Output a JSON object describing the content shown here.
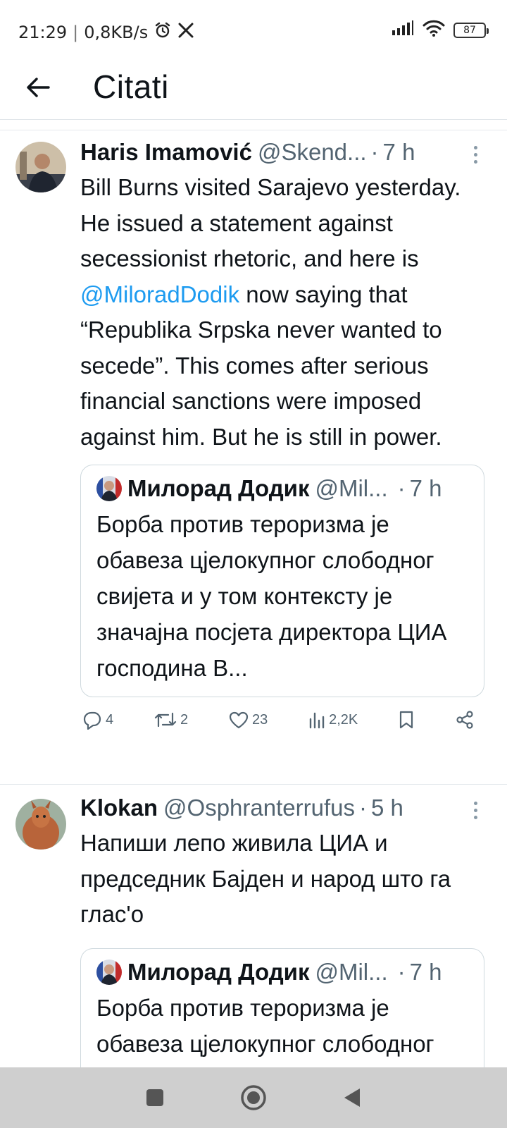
{
  "status_bar": {
    "time": "21:29",
    "speed": "0,8KB/s",
    "battery": "87",
    "icons": [
      "alarm-icon",
      "x-logo-icon",
      "signal-icon",
      "wifi-icon",
      "battery-icon"
    ]
  },
  "header": {
    "title": "Citati",
    "back_icon": "arrow-left-icon"
  },
  "tweets": [
    {
      "name": "Haris Imamović",
      "handle": "@Skend...",
      "sep": "·",
      "time": "7 h",
      "text_before": "Bill Burns visited Sarajevo yesterday. He issued a statement against secessionist rhetoric, and here is ",
      "mention": "@MiloradDodik",
      "text_after": " now saying that “Republika Srpska never wanted to secede”. This comes after serious financial sanctions were imposed against him. But he is still in power.",
      "quote": {
        "name": "Милорад Додик",
        "handle": "@Mil...",
        "sep": "·",
        "time": "7 h",
        "text": "Борба против тероризма је обавеза цјелокупног слободног свијета и у том контексту је значајна посјета директора ЦИА господина В..."
      },
      "actions": {
        "replies": "4",
        "reposts": "2",
        "likes": "23",
        "views": "2,2K"
      }
    },
    {
      "name": "Klokan",
      "handle": "@Osphranterrufus",
      "sep": "·",
      "time": "5 h",
      "text": "Напиши лепо живила ЦИА и председник Бајден и народ што га глас'о",
      "quote": {
        "name": "Милорад Додик",
        "handle": "@Mil...",
        "sep": "·",
        "time": "7 h",
        "text": "Борба против тероризма је обавеза цјелокупног слободног свијета и у том"
      }
    }
  ],
  "colors": {
    "text": "#0f1419",
    "secondary": "#536471",
    "link": "#1d9bf0",
    "border": "#cfd9de",
    "navbar": "#cfcfcf"
  }
}
